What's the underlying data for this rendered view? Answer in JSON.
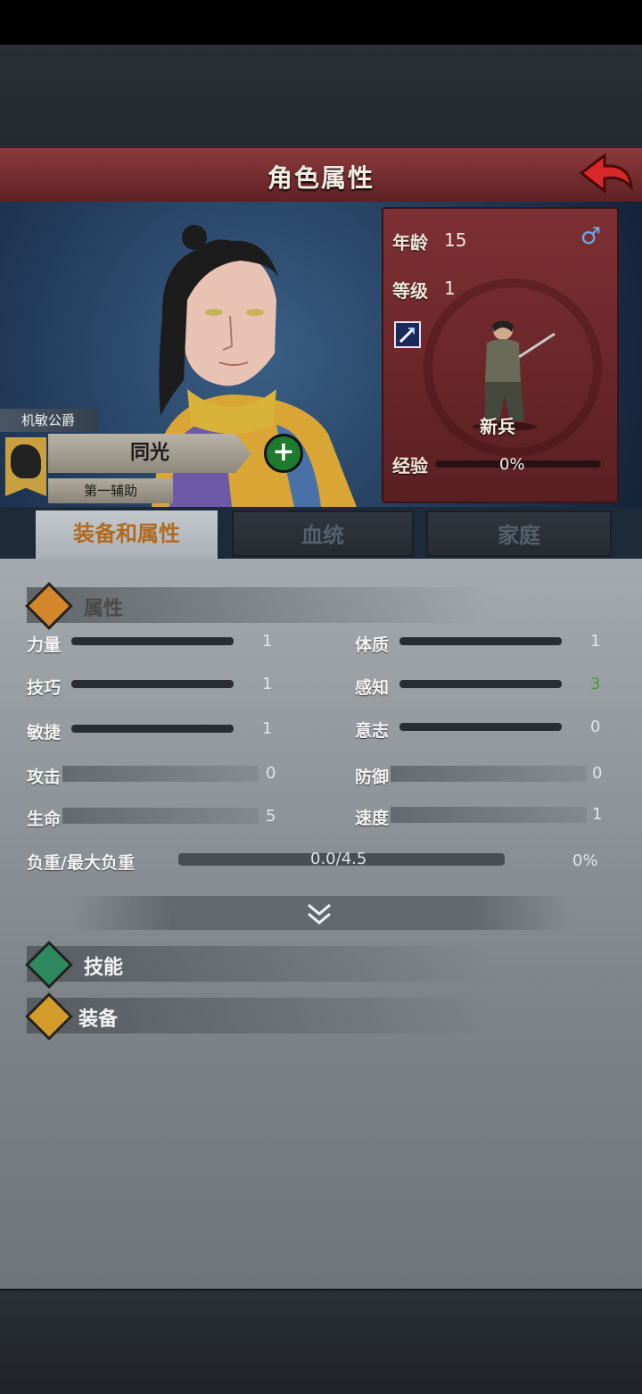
{
  "header": {
    "title": "角色属性"
  },
  "character": {
    "title": "机敏公爵",
    "name": "同光",
    "role": "第一辅助"
  },
  "stats_panel": {
    "age_label": "年龄",
    "age": "15",
    "level_label": "等级",
    "level": "1",
    "class_name": "新兵",
    "exp_label": "经验",
    "exp_pct": "0%",
    "exp_fraction": 0
  },
  "tabs": [
    {
      "label": "装备和属性",
      "active": true
    },
    {
      "label": "血统",
      "active": false
    },
    {
      "label": "家庭",
      "active": false
    }
  ],
  "sections": {
    "attributes": "属性",
    "skills": "技能",
    "equipment": "装备"
  },
  "attributes_left": [
    {
      "label": "力量",
      "value": "1"
    },
    {
      "label": "技巧",
      "value": "1"
    },
    {
      "label": "敏捷",
      "value": "1"
    },
    {
      "label": "攻击",
      "value": "0"
    },
    {
      "label": "生命",
      "value": "5"
    }
  ],
  "attributes_right": [
    {
      "label": "体质",
      "value": "1"
    },
    {
      "label": "感知",
      "value": "3"
    },
    {
      "label": "意志",
      "value": "0"
    },
    {
      "label": "防御",
      "value": "0"
    },
    {
      "label": "速度",
      "value": "1"
    }
  ],
  "load": {
    "label": "负重/最大负重",
    "value": "0.0/4.5",
    "pct": "0%"
  },
  "colors": {
    "header_red": "#8c3a3c",
    "tab_active_text": "#b06a1e",
    "attr_diamond": "#d4862a",
    "skill_diamond": "#2e8a5e",
    "equip_diamond": "#d49a2a"
  }
}
